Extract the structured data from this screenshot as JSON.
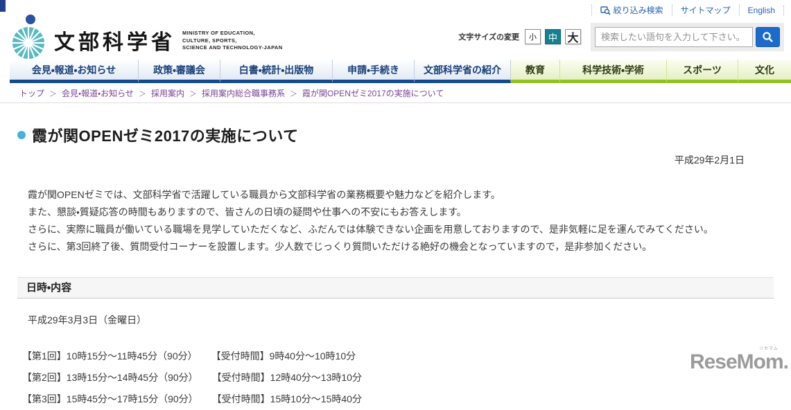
{
  "utility": {
    "links": [
      {
        "label": "絞り込み検索"
      },
      {
        "label": "サイトマップ"
      },
      {
        "label": "English"
      }
    ]
  },
  "header": {
    "site_name": "文部科学省",
    "site_name_en_lines": [
      "MINISTRY OF EDUCATION,",
      "CULTURE, SPORTS,",
      "SCIENCE AND TECHNOLOGY-JAPAN"
    ],
    "font_size": {
      "label": "文字サイズの変更",
      "options": [
        {
          "label": "小",
          "selected": false
        },
        {
          "label": "中",
          "selected": true
        },
        {
          "label": "大",
          "selected": false
        }
      ]
    },
    "search": {
      "placeholder": "検索したい語句を入力して下さい。"
    }
  },
  "nav": {
    "items": [
      {
        "label": "会見・報道・お知らせ",
        "group": "blue"
      },
      {
        "label": "政策・審議会",
        "group": "blue"
      },
      {
        "label": "白書・統計・出版物",
        "group": "blue"
      },
      {
        "label": "申請・手続き",
        "group": "blue"
      },
      {
        "label": "文部科学省の紹介",
        "group": "blue"
      },
      {
        "label": "教育",
        "group": "green"
      },
      {
        "label": "科学技術・学術",
        "group": "green"
      },
      {
        "label": "スポーツ",
        "group": "green"
      },
      {
        "label": "文化",
        "group": "green"
      }
    ]
  },
  "breadcrumb": {
    "separator": "＞",
    "items": [
      "トップ",
      "会見・報道・お知らせ",
      "採用案内",
      "採用案内総合職事務系",
      "霞が関OPENゼミ2017の実施について"
    ]
  },
  "main": {
    "title": "霞が関OPENゼミ2017の実施について",
    "published_date": "平成29年2月1日",
    "paragraphs": [
      "霞が関OPENゼミでは、文部科学省で活躍している職員から文部科学省の業務概要や魅力などを紹介します。",
      "また、懇談・質疑応答の時間もありますので、皆さんの日頃の疑問や仕事への不安にもお答えします。",
      "さらに、実際に職員が働いている職場を見学していただくなど、ふだんでは体験できない企画を用意しておりますので、是非気軽に足を運んでみてください。",
      "さらに、第3回終了後、質問受付コーナーを設置します。少人数でじっくり質問いただける絶好の機会となっていますので，是非参加ください。"
    ],
    "schedule": {
      "heading": "日時・内容",
      "event_date": "平成29年3月3日（金曜日）",
      "sessions": [
        {
          "round": "【第1回】10時15分～11時45分（90分）",
          "reception": "【受付時間】9時40分～10時10分"
        },
        {
          "round": "【第2回】13時15分～14時45分（90分）",
          "reception": "【受付時間】12時40分～13時10分"
        },
        {
          "round": "【第3回】15時45分～17時15分（90分）",
          "reception": "【受付時間】15時10分～15時40分"
        }
      ]
    }
  },
  "watermark": {
    "text": "ReseMom",
    "ruby": "リセマム",
    "suffix": "."
  },
  "colors": {
    "nav_blue_border": "#134a8e",
    "nav_green_border": "#90c31f",
    "brand_teal": "#58b9c3",
    "brand_navy": "#2a52a0",
    "selected_size_teal": "#17808f",
    "search_button_blue": "#1b6bcc",
    "utility_link_blue": "#2763ad",
    "breadcrumb_purple": "#7b4397",
    "title_bullet_blue": "#45b2d8"
  }
}
